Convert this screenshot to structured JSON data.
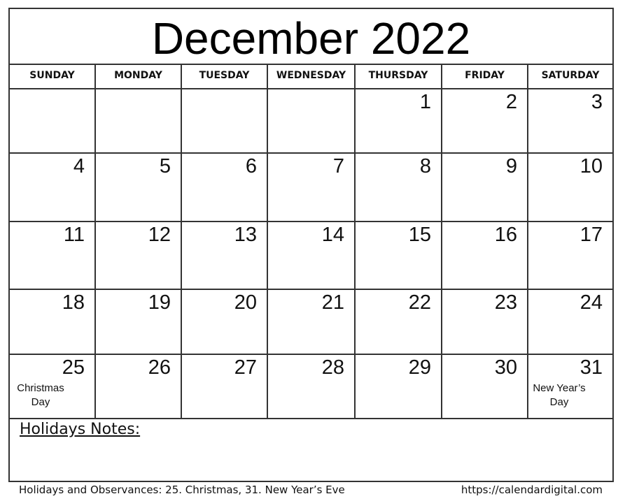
{
  "title": "December 2022",
  "weekdays": [
    "SUNDAY",
    "MONDAY",
    "TUESDAY",
    "WEDNESDAY",
    "THURSDAY",
    "FRIDAY",
    "SATURDAY"
  ],
  "weeks": [
    [
      {
        "day": ""
      },
      {
        "day": ""
      },
      {
        "day": ""
      },
      {
        "day": ""
      },
      {
        "day": "1"
      },
      {
        "day": "2"
      },
      {
        "day": "3"
      }
    ],
    [
      {
        "day": "4"
      },
      {
        "day": "5"
      },
      {
        "day": "6"
      },
      {
        "day": "7"
      },
      {
        "day": "8"
      },
      {
        "day": "9"
      },
      {
        "day": "10"
      }
    ],
    [
      {
        "day": "11"
      },
      {
        "day": "12"
      },
      {
        "day": "13"
      },
      {
        "day": "14"
      },
      {
        "day": "15"
      },
      {
        "day": "16"
      },
      {
        "day": "17"
      }
    ],
    [
      {
        "day": "18"
      },
      {
        "day": "19"
      },
      {
        "day": "20"
      },
      {
        "day": "21"
      },
      {
        "day": "22"
      },
      {
        "day": "23"
      },
      {
        "day": "24"
      }
    ],
    [
      {
        "day": "25",
        "holiday": "Christmas Day"
      },
      {
        "day": "26"
      },
      {
        "day": "27"
      },
      {
        "day": "28"
      },
      {
        "day": "29"
      },
      {
        "day": "30"
      },
      {
        "day": "31",
        "holiday": "New Year’s Day"
      }
    ]
  ],
  "notes": {
    "title": "Holidays Notes:"
  },
  "footer": {
    "observances": "Holidays and Observances: 25. Christmas, 31. New Year’s Eve",
    "url": "https://calendardigital.com"
  }
}
